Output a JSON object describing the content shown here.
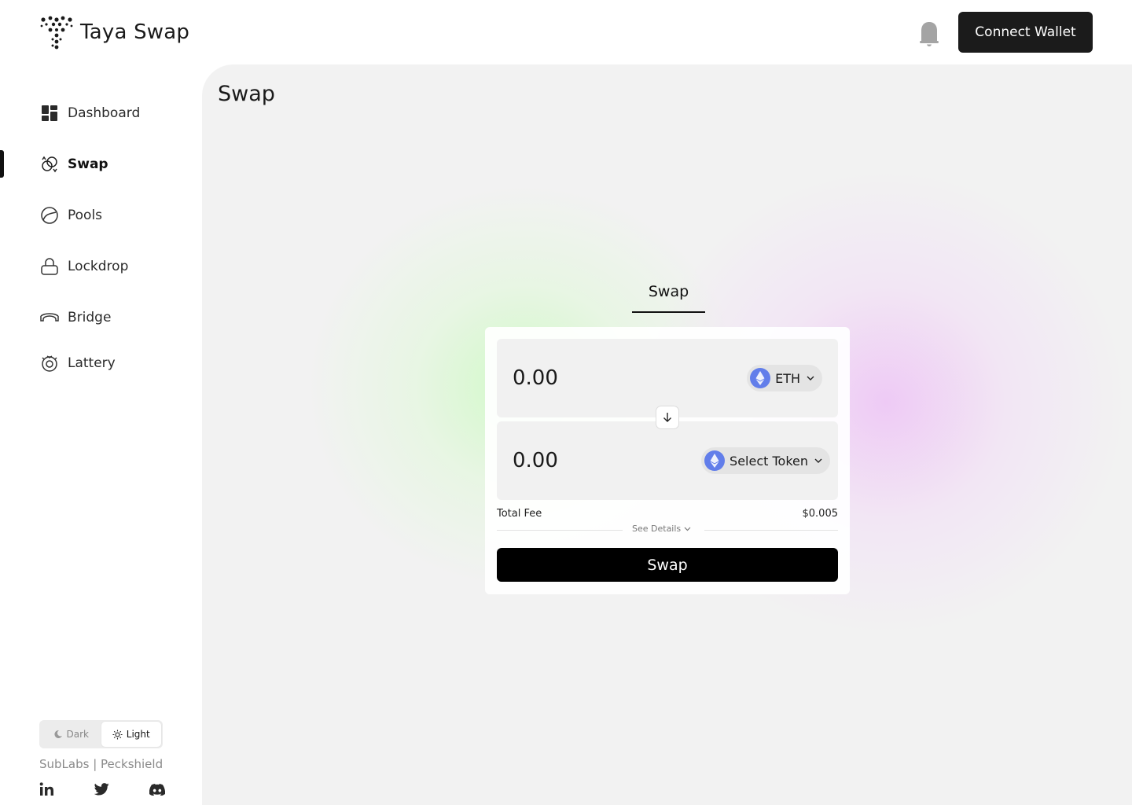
{
  "app": {
    "name": "Taya Swap",
    "connect_wallet_label": "Connect Wallet"
  },
  "sidebar": {
    "items": [
      {
        "label": "Dashboard",
        "icon": "dashboard-icon",
        "active": false
      },
      {
        "label": "Swap",
        "icon": "swap-icon",
        "active": true
      },
      {
        "label": "Pools",
        "icon": "pools-icon",
        "active": false
      },
      {
        "label": "Lockdrop",
        "icon": "lock-icon",
        "active": false
      },
      {
        "label": "Bridge",
        "icon": "bridge-icon",
        "active": false
      },
      {
        "label": "Lattery",
        "icon": "lottery-icon",
        "active": false
      }
    ],
    "theme": {
      "dark_label": "Dark",
      "light_label": "Light",
      "selected": "Light"
    },
    "credits": "SubLabs | Peckshield",
    "socials": [
      "linkedin-icon",
      "twitter-icon",
      "discord-icon"
    ]
  },
  "main": {
    "title": "Swap",
    "tab_label": "Swap",
    "from": {
      "amount": "0.00",
      "token": "ETH"
    },
    "to": {
      "amount": "0.00",
      "token": "Select Token"
    },
    "fee_label": "Total Fee",
    "fee_value": "$0.005",
    "details_label": "See Details",
    "swap_button_label": "Swap"
  },
  "colors": {
    "accent": "#000000",
    "eth": "#627eea",
    "panel_bg": "#f2f2f2"
  }
}
